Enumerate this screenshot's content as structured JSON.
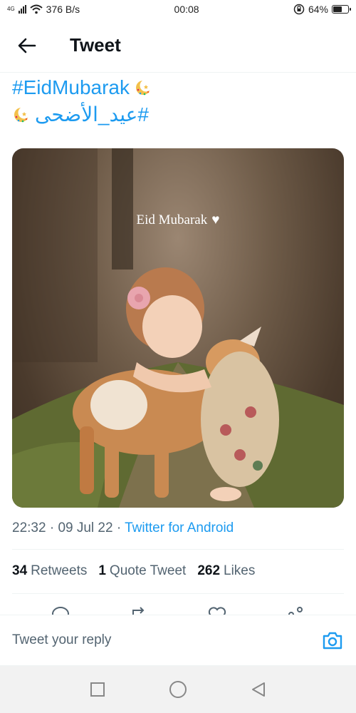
{
  "status_bar": {
    "network_label": "4G",
    "speed": "376 B/s",
    "time": "00:08",
    "battery_percent": "64%",
    "battery_level": 0.64
  },
  "header": {
    "title": "Tweet",
    "back_icon": "arrow-left-icon"
  },
  "tweet": {
    "hashtag_en": "#EidMubarak",
    "hashtag_ar": "#عيد_الأضحى",
    "image_text": "Eid Mubarak",
    "time": "22:32",
    "separator": "·",
    "date": "09 Jul 22",
    "source": "Twitter for Android"
  },
  "stats": {
    "retweets_count": "34",
    "retweets_label": "Retweets",
    "quotes_count": "1",
    "quotes_label": "Quote Tweet",
    "likes_count": "262",
    "likes_label": "Likes"
  },
  "reply": {
    "placeholder": "Tweet your reply"
  },
  "colors": {
    "accent": "#1d9bf0",
    "text_primary": "#0f1419",
    "text_secondary": "#536471"
  }
}
